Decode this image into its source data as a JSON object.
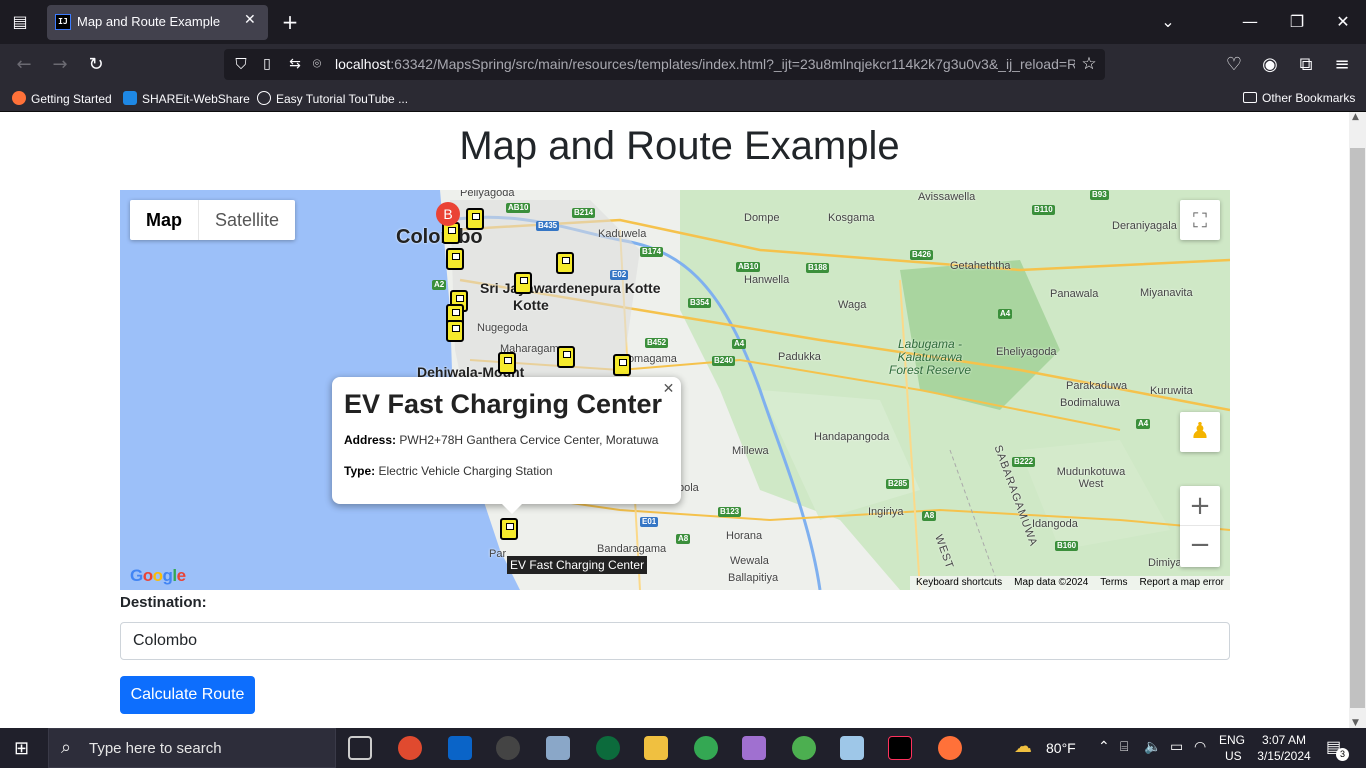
{
  "browser": {
    "tab_title": "Map and Route Example",
    "tab_favicon": "IJ",
    "url_host": "localhost",
    "url_rest": ":63342/MapsSpring/src/main/resources/templates/index.html?_ijt=23u8mlnqjekcr114k2k7g3u0v3&_ij_reload=R",
    "bookmarks": [
      {
        "label": "Getting Started",
        "color": "#ff7139"
      },
      {
        "label": "SHAREit-WebShare",
        "color": "#1e88e5"
      },
      {
        "label": "Easy Tutorial TouTube ...",
        "color": "#9e9e9e"
      }
    ],
    "other_bookmarks": "Other Bookmarks"
  },
  "page": {
    "heading": "Map and Route Example",
    "map_type": {
      "map": "Map",
      "satellite": "Satellite"
    },
    "info_window": {
      "title": "EV Fast Charging Center",
      "address_label": "Address:",
      "address": "PWH2+78H Ganthera Cervice Center, Moratuwa",
      "type_label": "Type:",
      "type": "Electric Vehicle Charging Station"
    },
    "marker_b": "B",
    "tooltip": "EV Fast Charging Center",
    "google_logo": "Google",
    "attribution": [
      "Keyboard shortcuts",
      "Map data ©2024",
      "Terms",
      "Report a map error"
    ],
    "destination_label": "Destination:",
    "destination_value": "Colombo",
    "calculate_button": "Calculate Route"
  },
  "map_labels": {
    "colombo": "Colombo",
    "kotte": "Sri Jayawardenepura Kotte",
    "kotte2": "Kotte",
    "dehiwala": "Dehiwala-Mount",
    "peliyagoda": "Peliyagoda",
    "kaduwela": "Kaduwela",
    "dompe": "Dompe",
    "kosgama": "Kosgama",
    "avissawella": "Avissawella",
    "deraniyagala": "Deraniyagala",
    "hanwella": "Hanwella",
    "getahetha": "Getaheththa",
    "panawala": "Panawala",
    "miyanavita": "Miyanavita",
    "waga": "Waga",
    "nugegoda": "Nugegoda",
    "maharagama": "Maharagam",
    "homagama": "Homagama",
    "padukka": "Padukka",
    "labugama": "Labugama - Kalatuwawa Forest Reserve",
    "eheliyagoda": "Eheliyagoda",
    "parakaduwa": "Parakaduwa",
    "kuruwita": "Kuruwita",
    "bodimaluwa": "Bodimaluwa",
    "handapangoda": "Handapangoda",
    "millewa": "Millewa",
    "mudunkotuwa": "Mudunkotuwa West",
    "ingiriya": "Ingiriya",
    "idangoda": "Idangoda",
    "horana": "Horana",
    "bandaragama": "Bandaragama",
    "wewala": "Wewala",
    "ballapitiya": "Ballapitiya",
    "dimiyawa": "Dimiyawa",
    "sabaragamuwa": "SABARAGAMUWA",
    "western": "WEST",
    "pol": "pola",
    "par": "Par"
  },
  "taskbar": {
    "search_placeholder": "Type here to search",
    "weather": "80°F",
    "lang": "ENG",
    "region": "US",
    "time": "3:07 AM",
    "date": "3/15/2024",
    "notif": "3"
  },
  "colors": {
    "accent": "#0d6efd",
    "marker": "#ea4335",
    "water": "#9cc0f9",
    "forest": "#c8e6c0",
    "land": "#f0f0ef"
  }
}
